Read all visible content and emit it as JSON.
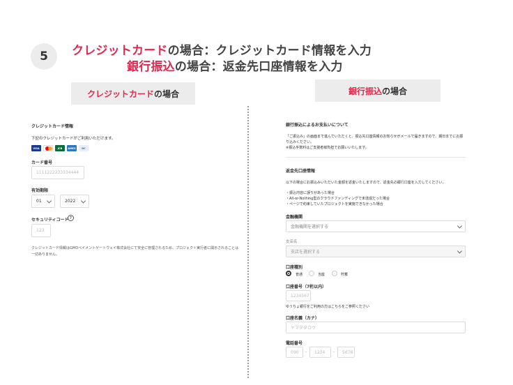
{
  "step_number": "5",
  "headline": {
    "line1_highlight": "クレジットカード",
    "line1_rest": "の場合：クレジットカード情報を入力",
    "line2_highlight": "銀行振込",
    "line2_rest": "の場合：返金先口座情報を入力"
  },
  "labels": {
    "left_highlight": "クレジットカード",
    "left_rest": "の場合",
    "right_highlight": "銀行振込",
    "right_rest": "の場合"
  },
  "credit_card_form": {
    "title": "クレジットカード情報",
    "subtitle": "下記のクレジットカードがご利用いただけます。",
    "brands": [
      "VISA",
      "MC",
      "JCB",
      "AMEX",
      "DC"
    ],
    "card_number_label": "カード番号",
    "card_number_placeholder": "1111222233334444",
    "expiry_label": "有効期限",
    "expiry_month": "01",
    "expiry_year": "2022",
    "security_code_label": "セキュリティコード",
    "security_code_placeholder": "123",
    "help_symbol": "?",
    "notice": "クレジットカード情報はGMOペイメントゲートウェイ株式会社にて安全に管理されるため、プロジェクト実行者に開示されることは一切ありません。"
  },
  "bank_form": {
    "title": "銀行振込によるお支払いについて",
    "desc1": "「ご振込み」の画面まで進んでいただくと、振込先口座情報のお知らせがメールで届きますので、期日までにお振",
    "desc2": "り込みください。",
    "desc3": "※振込手数料はご支援者様負担でお願いいたします。",
    "refund_title": "返金先口座情報",
    "refund_desc": "以下の場合にお振込みいただいた金額を返金いたしますので、返金先の銀行口座を入力してください。",
    "refund_cases": [
      "・振込内容に誤りがあった場合",
      "・All-or-Nothing型のクラウドファンディングで未達成だった場合",
      "・ページで約束していたプロジェクトを実施できなかった場合"
    ],
    "bank_label": "金融機関",
    "bank_placeholder": "金融機関を選択する",
    "branch_label": "支店名",
    "branch_placeholder": "支店を選択する",
    "account_type_label": "口座種別",
    "account_types": [
      "普通",
      "当座",
      "貯蓄"
    ],
    "account_number_label": "口座番号（7桁以内）",
    "account_number_placeholder": "1234567",
    "yucho_note": "ゆうちょ銀行をご利用の方はこちらをご参照ください",
    "account_name_label": "口座名義（カナ）",
    "account_name_placeholder": "ヤマダタロウ",
    "phone_label": "電話番号",
    "phone_placeholders": [
      "090",
      "1234",
      "5678"
    ],
    "phone_sep": "-"
  }
}
